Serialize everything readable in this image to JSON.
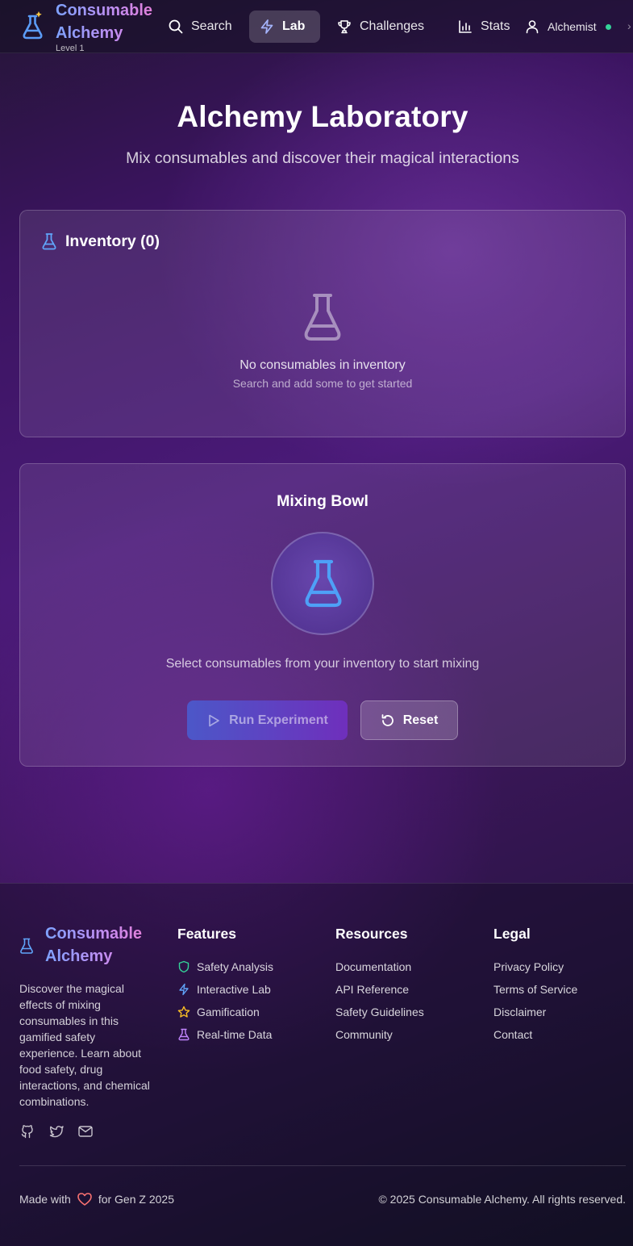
{
  "header": {
    "brand_title": "Consumable Alchemy",
    "level": "Level 1",
    "nav": [
      {
        "label": "Search",
        "icon": "search-icon"
      },
      {
        "label": "Lab",
        "icon": "lightning-icon",
        "active": true
      },
      {
        "label": "Challenges",
        "icon": "trophy-icon"
      },
      {
        "label": "Stats",
        "icon": "bar-chart-icon"
      }
    ],
    "user": {
      "name": "Alchemist",
      "icon": "user-icon",
      "status": "online"
    }
  },
  "hero": {
    "title": "Alchemy Laboratory",
    "subtitle": "Mix consumables and discover their magical interactions"
  },
  "inventory": {
    "title": "Inventory (0)",
    "empty_title": "No consumables in inventory",
    "empty_hint": "Search and add some to get started"
  },
  "mixing": {
    "title": "Mixing Bowl",
    "hint": "Select consumables from your inventory to start mixing",
    "run_label": "Run Experiment",
    "reset_label": "Reset"
  },
  "footer": {
    "brand_title": "Consumable Alchemy",
    "description": "Discover the magical effects of mixing consumables in this gamified safety experience. Learn about food safety, drug interactions, and chemical combinations.",
    "socials": [
      "github-icon",
      "twitter-icon",
      "mail-icon"
    ],
    "columns": {
      "features": {
        "title": "Features",
        "items": [
          {
            "label": "Safety Analysis",
            "icon": "shield-icon"
          },
          {
            "label": "Interactive Lab",
            "icon": "lightning-icon"
          },
          {
            "label": "Gamification",
            "icon": "star-icon"
          },
          {
            "label": "Real-time Data",
            "icon": "flask-icon"
          }
        ]
      },
      "resources": {
        "title": "Resources",
        "items": [
          "Documentation",
          "API Reference",
          "Safety Guidelines",
          "Community"
        ]
      },
      "legal": {
        "title": "Legal",
        "items": [
          "Privacy Policy",
          "Terms of Service",
          "Disclaimer",
          "Contact"
        ]
      }
    },
    "made_with_prefix": "Made with",
    "made_with_suffix": "for Gen Z 2025",
    "copyright": "© 2025 Consumable Alchemy. All rights reserved."
  },
  "colors": {
    "accent_blue": "#60a5fa",
    "brand_gradient_start": "#7ea2ff",
    "brand_gradient_end": "#ee7ad0",
    "online": "#34d399",
    "heart": "#f87171",
    "star": "#fbbf24",
    "shield": "#34d399"
  }
}
